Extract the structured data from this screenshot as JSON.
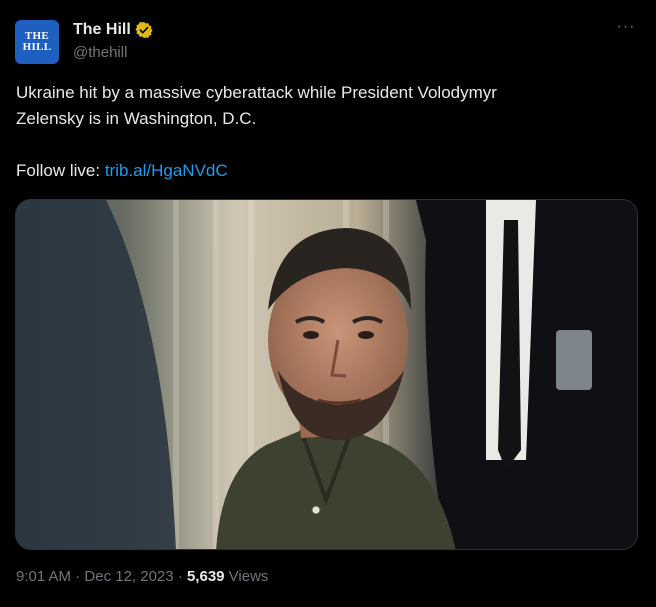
{
  "author": {
    "avatar_text_line1": "THE",
    "avatar_text_line2": "HILL",
    "name": "The Hill",
    "handle": "@thehill",
    "verified_badge_icon": "verified-gold-badge-icon",
    "avatar_color": "#1f5fbf",
    "badge_color": "#e2b719"
  },
  "menu": {
    "more_label": "···"
  },
  "tweet": {
    "text_line1": "Ukraine hit by a massive cyberattack while President Volodymyr",
    "text_line2": "Zelensky is in Washington, D.C.",
    "follow_prefix": "Follow live: ",
    "link_text": "trib.al/HgaNVdC",
    "link_color": "#1d9bf0"
  },
  "media": {
    "type": "photo"
  },
  "footer": {
    "time": "9:01 AM",
    "separator1": " · ",
    "date": "Dec 12, 2023",
    "separator2": " · ",
    "views_count": "5,639",
    "views_label": " Views"
  }
}
